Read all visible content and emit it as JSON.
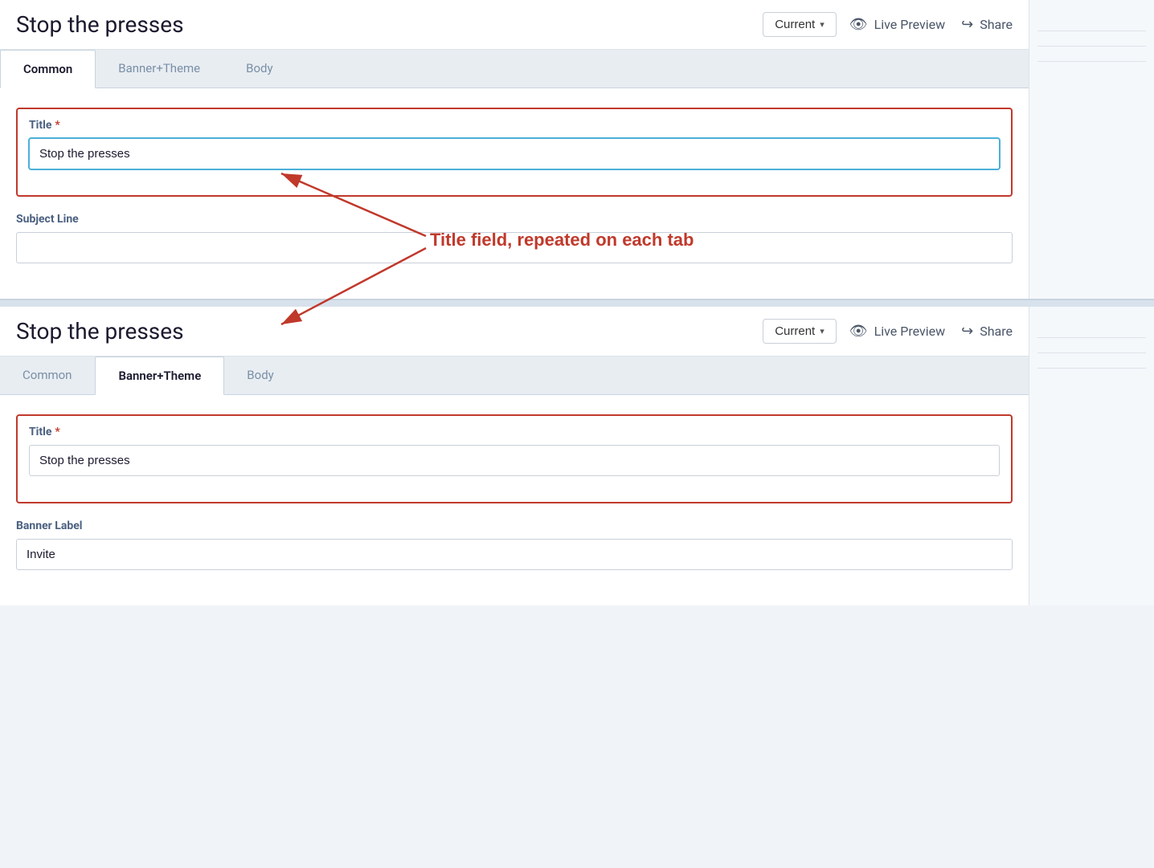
{
  "page": {
    "title": "Stop the presses",
    "current_btn": "Current",
    "current_btn_chevron": "▾",
    "live_preview_label": "Live Preview",
    "share_label": "Share"
  },
  "tabs": {
    "top": [
      {
        "id": "common",
        "label": "Common",
        "active": true
      },
      {
        "id": "banner-theme",
        "label": "Banner+Theme",
        "active": false
      },
      {
        "id": "body",
        "label": "Body",
        "active": false
      }
    ],
    "bottom": [
      {
        "id": "common2",
        "label": "Common",
        "active": false
      },
      {
        "id": "banner-theme2",
        "label": "Banner+Theme",
        "active": true
      },
      {
        "id": "body2",
        "label": "Body",
        "active": false
      }
    ]
  },
  "top_panel": {
    "title_field": {
      "label": "Title",
      "required": true,
      "value": "Stop the presses",
      "placeholder": ""
    },
    "subject_line_field": {
      "label": "Subject Line",
      "required": false,
      "value": "",
      "placeholder": ""
    }
  },
  "bottom_panel": {
    "title_field": {
      "label": "Title",
      "required": true,
      "value": "Stop the presses",
      "placeholder": ""
    },
    "banner_label_field": {
      "label": "Banner Label",
      "required": false,
      "value": "Invite",
      "placeholder": ""
    }
  },
  "annotation": {
    "text": "Title field, repeated on each tab",
    "color": "#c0392b"
  },
  "icons": {
    "eye": "👁",
    "share": "↪"
  }
}
